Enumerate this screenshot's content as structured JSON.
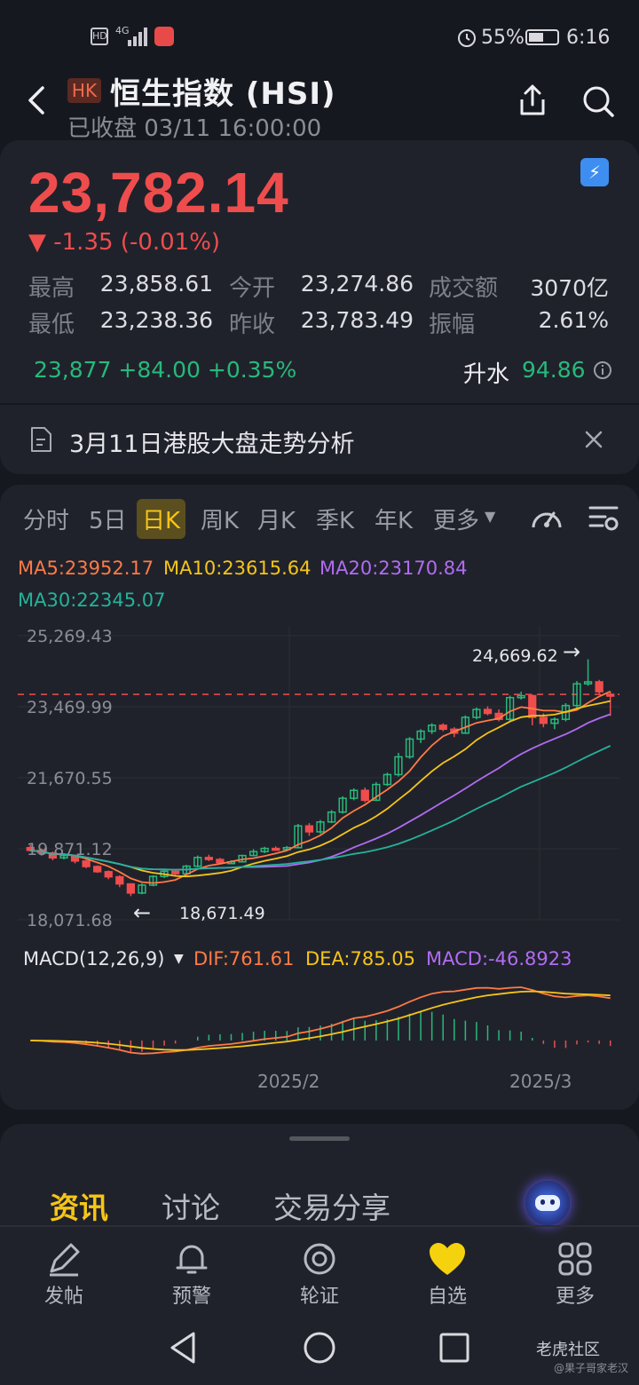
{
  "status_bar": {
    "left_icons": "HD 4G",
    "battery": "55%",
    "time": "6:16"
  },
  "header": {
    "market_badge": "HK",
    "title": "恒生指数 (HSI)",
    "subtitle": "已收盘 03/11 16:00:00"
  },
  "quote": {
    "price": "23,782.14",
    "change": "▼ -1.35 (-0.01%)",
    "stats": [
      {
        "label": "最高",
        "value": "23,858.61"
      },
      {
        "label": "今开",
        "value": "23,274.86"
      },
      {
        "label": "成交额",
        "value": "3070亿"
      },
      {
        "label": "最低",
        "value": "23,238.36"
      },
      {
        "label": "昨收",
        "value": "23,783.49"
      },
      {
        "label": "振幅",
        "value": "2.61%"
      }
    ],
    "futures": "23,877 +84.00 +0.35%",
    "premium_label": "升水",
    "premium_value": "94.86"
  },
  "news_banner": {
    "text": "3月11日港股大盘走势分析"
  },
  "chart_tabs": [
    "分时",
    "5日",
    "日K",
    "周K",
    "月K",
    "季K",
    "年K",
    "更多"
  ],
  "active_tab": "日K",
  "ma_legend": {
    "ma5": "MA5:23952.17",
    "ma10": "MA10:23615.64",
    "ma20": "MA20:23170.84",
    "ma30": "MA30:22345.07"
  },
  "colors": {
    "up": "#ef4d4d",
    "down": "#27b97a",
    "ma5": "#ff7a45",
    "ma10": "#f5c518",
    "ma20": "#b06cf2",
    "ma30": "#23b39a",
    "accent": "#f5c518"
  },
  "chart_data": {
    "type": "candlestick",
    "y_ticks": [
      "25,269.43",
      "23,469.99",
      "21,670.55",
      "19,871.12",
      "18,071.68"
    ],
    "ylim": [
      18071.68,
      25269.43
    ],
    "x_ticks": [
      "2025/2",
      "2025/3"
    ],
    "high_marker": "24,669.62",
    "low_marker": "18,671.49",
    "last_close_line": 23782.14,
    "candles": [
      [
        19900,
        19830,
        19960,
        19800
      ],
      [
        19830,
        19760,
        19880,
        19700
      ],
      [
        19760,
        19640,
        19800,
        19580
      ],
      [
        19640,
        19700,
        19740,
        19600
      ],
      [
        19700,
        19560,
        19720,
        19500
      ],
      [
        19560,
        19420,
        19590,
        19380
      ],
      [
        19420,
        19290,
        19450,
        19260
      ],
      [
        19290,
        19160,
        19320,
        19100
      ],
      [
        19160,
        18980,
        19200,
        18900
      ],
      [
        18980,
        18750,
        19000,
        18671
      ],
      [
        18750,
        18950,
        18990,
        18720
      ],
      [
        18950,
        19170,
        19200,
        18920
      ],
      [
        19170,
        19300,
        19330,
        19130
      ],
      [
        19300,
        19240,
        19340,
        19200
      ],
      [
        19240,
        19430,
        19460,
        19220
      ],
      [
        19430,
        19650,
        19700,
        19400
      ],
      [
        19650,
        19600,
        19720,
        19560
      ],
      [
        19600,
        19520,
        19640,
        19480
      ],
      [
        19520,
        19540,
        19580,
        19490
      ],
      [
        19540,
        19700,
        19720,
        19520
      ],
      [
        19700,
        19800,
        19860,
        19680
      ],
      [
        19800,
        19880,
        19920,
        19760
      ],
      [
        19880,
        19850,
        19930,
        19820
      ],
      [
        19850,
        19900,
        19940,
        19830
      ],
      [
        19900,
        20450,
        20500,
        19880
      ],
      [
        20450,
        20300,
        20520,
        20200
      ],
      [
        20300,
        20550,
        20600,
        20250
      ],
      [
        20550,
        20800,
        20850,
        20520
      ],
      [
        20800,
        21150,
        21200,
        20760
      ],
      [
        21150,
        21350,
        21400,
        21100
      ],
      [
        21350,
        21100,
        21420,
        21050
      ],
      [
        21100,
        21500,
        21560,
        21080
      ],
      [
        21500,
        21750,
        21800,
        21460
      ],
      [
        21750,
        22200,
        22300,
        21700
      ],
      [
        22200,
        22650,
        22700,
        22150
      ],
      [
        22650,
        22850,
        22900,
        22550
      ],
      [
        22850,
        23000,
        23050,
        22780
      ],
      [
        23000,
        22900,
        23050,
        22850
      ],
      [
        22900,
        22800,
        22950,
        22700
      ],
      [
        22800,
        23200,
        23250,
        22780
      ],
      [
        23200,
        23400,
        23450,
        23150
      ],
      [
        23400,
        23300,
        23480,
        23250
      ],
      [
        23300,
        23150,
        23400,
        23100
      ],
      [
        23150,
        23700,
        23750,
        23100
      ],
      [
        23700,
        23750,
        23850,
        23650
      ],
      [
        23750,
        23200,
        23780,
        23000
      ],
      [
        23200,
        23050,
        23300,
        22950
      ],
      [
        23050,
        23150,
        23200,
        22900
      ],
      [
        23150,
        23500,
        23560,
        23100
      ],
      [
        23500,
        24050,
        24120,
        23450
      ],
      [
        24050,
        24100,
        24669.62,
        24000
      ],
      [
        24100,
        23850,
        24150,
        23800
      ],
      [
        23783.49,
        23782.14,
        23858.61,
        23238.36
      ]
    ],
    "macd_indicator": "MACD(12,26,9)",
    "dif": "DIF:761.61",
    "dea": "DEA:785.05",
    "macd": "MACD:-46.8923"
  },
  "bottom_sheet": {
    "tabs": [
      "资讯",
      "讨论",
      "交易分享"
    ],
    "active": "资讯"
  },
  "bottom_nav": [
    {
      "label": "发帖",
      "icon": "edit-icon"
    },
    {
      "label": "预警",
      "icon": "bell-icon"
    },
    {
      "label": "轮证",
      "icon": "warrant-icon"
    },
    {
      "label": "自选",
      "icon": "heart-icon"
    },
    {
      "label": "更多",
      "icon": "grid-icon"
    }
  ],
  "watermark": {
    "line1": "老虎社区",
    "line2": "@果子哥家老汉"
  }
}
